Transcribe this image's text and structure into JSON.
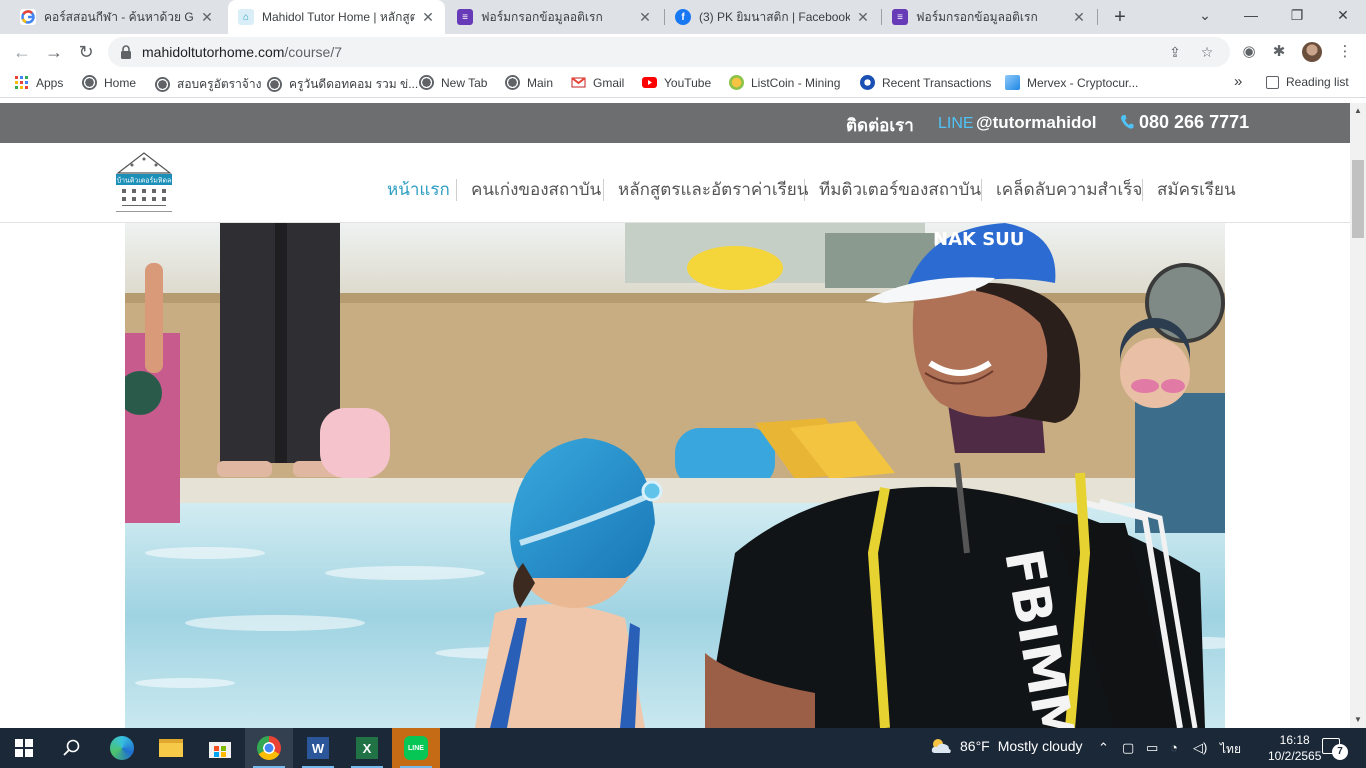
{
  "browser": {
    "tabs": [
      {
        "title": "คอร์สสอนกีฬา - ค้นหาด้วย Google",
        "favicon": "google-icon",
        "active": false
      },
      {
        "title": "Mahidol Tutor Home | หลักสูตร",
        "favicon": "mahidol-icon",
        "active": true
      },
      {
        "title": "ฟอร์มกรอกข้อมูลอติเรก",
        "favicon": "forms-icon",
        "active": false
      },
      {
        "title": "(3) PK ยิมนาสติก | Facebook",
        "favicon": "facebook-icon",
        "active": false
      },
      {
        "title": "ฟอร์มกรอกข้อมูลอติเรก",
        "favicon": "forms-icon",
        "active": false
      }
    ],
    "url_host": "mahidoltutorhome.com",
    "url_path": "/course/7",
    "bookmarks": [
      {
        "label": "Apps",
        "icon": "apps-grid-icon"
      },
      {
        "label": "Home",
        "icon": "globe-icon"
      },
      {
        "label": "สอบครูอัตราจ้าง",
        "icon": "globe-icon"
      },
      {
        "label": "ครูวันดีดอทคอม รวม ข่...",
        "icon": "globe-icon"
      },
      {
        "label": "New Tab",
        "icon": "globe-icon"
      },
      {
        "label": "Main",
        "icon": "globe-icon"
      },
      {
        "label": "Gmail",
        "icon": "gmail-icon"
      },
      {
        "label": "YouTube",
        "icon": "youtube-icon"
      },
      {
        "label": "ListCoin - Mining",
        "icon": "listcoin-icon"
      },
      {
        "label": "Recent Transactions",
        "icon": "coin-icon"
      },
      {
        "label": "Mervex - Cryptocur...",
        "icon": "mervex-icon"
      }
    ],
    "more_bookmarks": "»",
    "reading_list": "Reading list"
  },
  "site": {
    "contact_label": "ติดต่อเรา",
    "line_label": "LINE",
    "line_id": "@tutormahidol",
    "phone": "080 266 7771",
    "logo_text": "บ้านติวเตอร์มหิดล",
    "nav": [
      {
        "label": "หน้าแรก",
        "active": true
      },
      {
        "label": "คนเก่งของสถาบัน",
        "active": false
      },
      {
        "label": "หลักสูตรและอัตราค่าเรียน",
        "active": false
      },
      {
        "label": "ทีมติวเตอร์ของสถาบัน",
        "active": false
      },
      {
        "label": "เคล็ดลับความสำเร็จ",
        "active": false
      },
      {
        "label": "สมัครเรียน",
        "active": false
      }
    ],
    "hero_cap_text": "NAK SUU",
    "hero_shirt_text": "FBIMM",
    "accent_color": "#2c9ec2",
    "topbar_color": "#6d6e70"
  },
  "taskbar": {
    "weather_temp": "86°F",
    "weather_text": "Mostly cloudy",
    "language": "ไทย",
    "time": "16:18",
    "date": "10/2/2565",
    "notification_count": "7"
  }
}
